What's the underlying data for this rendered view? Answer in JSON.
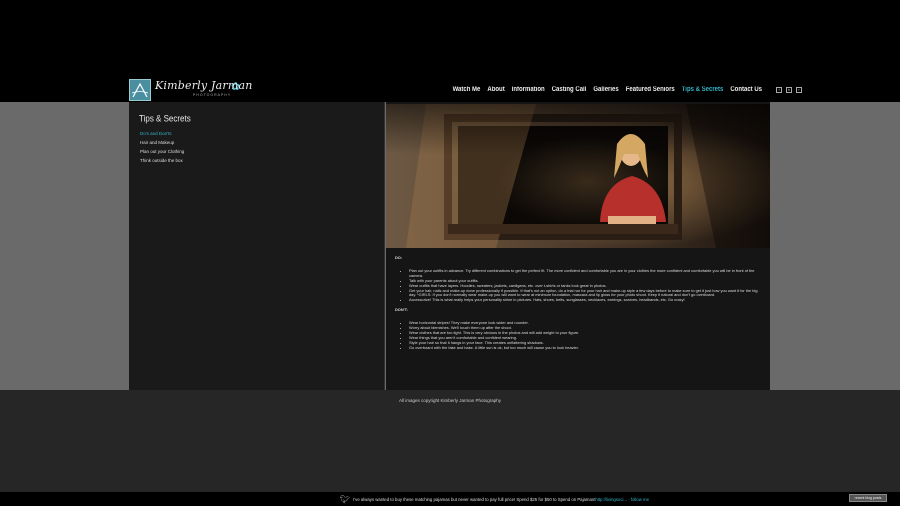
{
  "brand": {
    "script_name": "Kimberly Jarman",
    "subtitle": "PHOTOGRAPHY"
  },
  "nav": {
    "items": [
      {
        "label": "Watch Me"
      },
      {
        "label": "About"
      },
      {
        "label": "Information"
      },
      {
        "label": "Casting Call"
      },
      {
        "label": "Galleries"
      },
      {
        "label": "Featured Seniors"
      },
      {
        "label": "Tips & Secrets",
        "active": true
      },
      {
        "label": "Contact Us"
      }
    ],
    "social": [
      "facebook-icon",
      "blog-icon",
      "share-icon"
    ]
  },
  "sidebar": {
    "title": "Tips & Secrets",
    "items": [
      {
        "label": "Do's and Don'ts",
        "active": true
      },
      {
        "label": "Hair and Makeup"
      },
      {
        "label": "Plan out your Clothing"
      },
      {
        "label": "Think outside the box"
      }
    ]
  },
  "content": {
    "do_heading": "DO:",
    "do_items": [
      "Plan out your outfits in advance. Try different combinations to get the perfect fit. The more confident and comfortable you are in your clothes the more confident and comfortable you will be in front of the camera.",
      "Talk with your parents about your outfits.",
      "Wear outfits that have layers. Hoodies, sweaters, jackets, cardigans, etc. over t-shirts or tanks look great in photos.",
      "Get your hair, nails and make-up done professionally if possible. If that's not an option, do a trial run for your hair and make-up style a few days before to make sure to get it just how you want it for the big day. *GIRLS: If you don't normally wear make-up you will want to wear at minimum foundation, mascara and lip gloss for your photo shoot. Keep it natural and don't go overboard.",
      "Accessorize! This is what really helps your personality shine in pictures. Hats, shoes, belts, sunglasses, necklaces, earrings, scarves, headbands, etc. Go crazy!"
    ],
    "dont_heading": "DON'T:",
    "dont_items": [
      "Wear horizontal stripes! They make everyone look wider and rounder.",
      "Worry about blemishes. We'll touch them up after the shoot.",
      "Wear clothes that are too tight. This is very obvious in the photos and will add weight to your figure.",
      "Wear things that you aren't comfortable and confident wearing.",
      "Style your hair so that it hangs in your face. This creates unflattering shadows.",
      "Go overboard with the fake and bake. A little sun is ok, but too much will cause you to look heavier."
    ]
  },
  "footer": {
    "copyright": "All images copyright Kimberly Jarman Photography"
  },
  "twitter": {
    "tweet": "I've always wanted to buy these matching pajamas but never wanted to pay full price! Spend $25 for $50 to Spend on Pajamas!",
    "link": "http://livingsoci... · follow me",
    "recent_button": "recent blog posts"
  }
}
